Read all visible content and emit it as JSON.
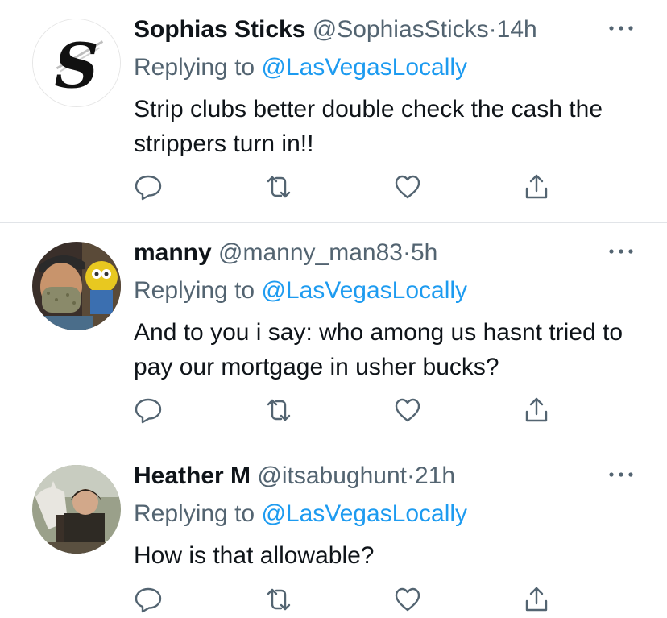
{
  "tweets": [
    {
      "name": "Sophias Sticks",
      "handle": "@SophiasSticks",
      "dot": "·",
      "time": "14h",
      "replying_prefix": "Replying to ",
      "replying_to": "@LasVegasLocally",
      "text": "Strip clubs better double check the cash the strippers turn in!!",
      "avatar_letter": "S"
    },
    {
      "name": "manny",
      "handle": "@manny_man83",
      "dot": "·",
      "time": "5h",
      "replying_prefix": "Replying to ",
      "replying_to": "@LasVegasLocally",
      "text": "And to you i say: who among us hasnt tried to pay our mortgage in usher bucks?"
    },
    {
      "name": "Heather M",
      "handle": "@itsabughunt",
      "dot": "·",
      "time": "21h",
      "replying_prefix": "Replying to ",
      "replying_to": "@LasVegasLocally",
      "text": "How is that allowable?"
    }
  ],
  "icons": {
    "more": "more-options-icon",
    "reply": "reply-icon",
    "retweet": "retweet-icon",
    "like": "like-icon",
    "share": "share-icon"
  },
  "colors": {
    "name": "#0f1419",
    "secondary": "#536471",
    "link": "#1d9bf0",
    "divider": "#e1e4e8"
  }
}
